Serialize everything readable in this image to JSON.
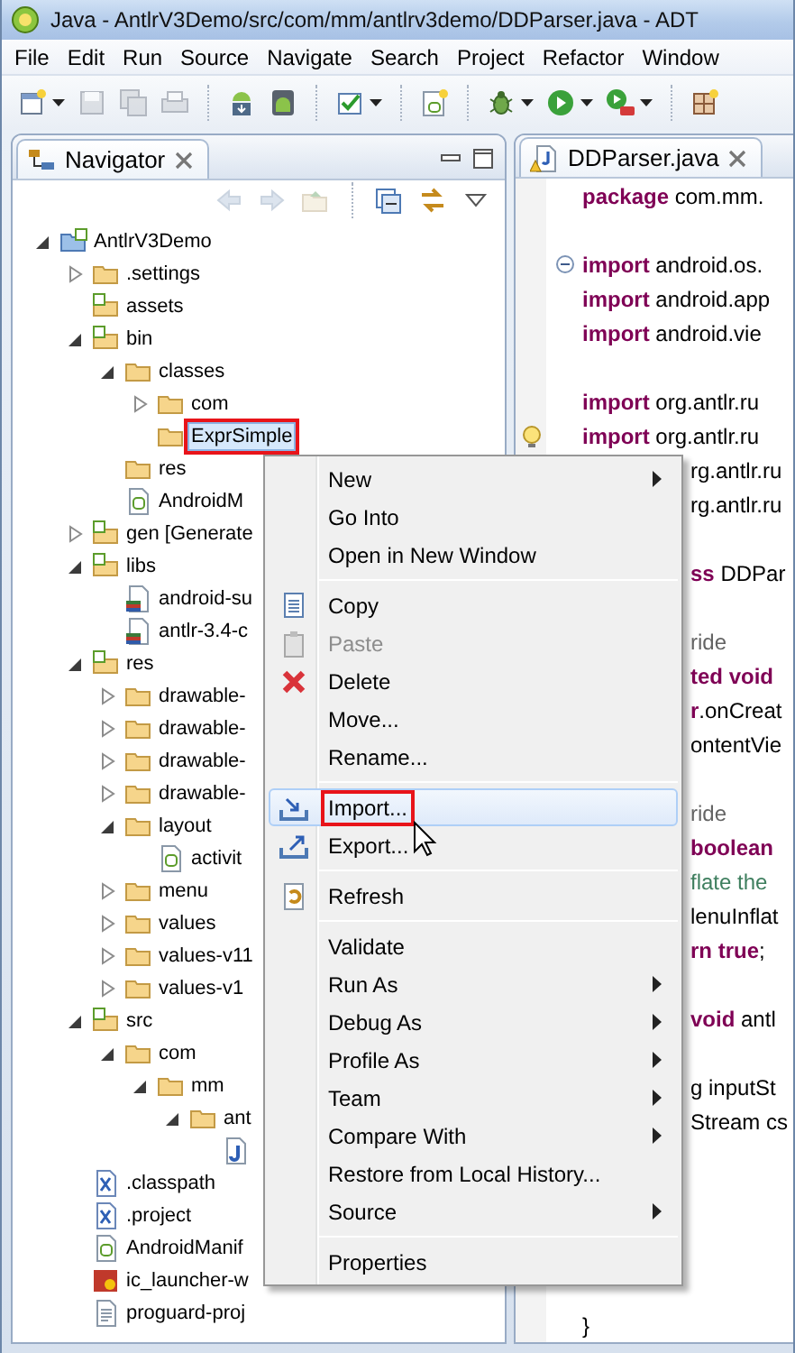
{
  "window": {
    "title": "Java - AntlrV3Demo/src/com/mm/antlrv3demo/DDParser.java - ADT"
  },
  "menu_bar": [
    "File",
    "Edit",
    "Run",
    "Source",
    "Navigate",
    "Search",
    "Project",
    "Refactor",
    "Window"
  ],
  "toolbar": [
    {
      "kind": "new",
      "disabled": false,
      "dropdown": true
    },
    {
      "kind": "save",
      "disabled": true,
      "dropdown": false
    },
    {
      "kind": "save-all",
      "disabled": true,
      "dropdown": false
    },
    {
      "kind": "print",
      "disabled": true,
      "dropdown": false
    },
    {
      "kind": "separator"
    },
    {
      "kind": "sdk",
      "disabled": false,
      "dropdown": false
    },
    {
      "kind": "avd",
      "disabled": false,
      "dropdown": false
    },
    {
      "kind": "separator"
    },
    {
      "kind": "task",
      "disabled": false,
      "dropdown": true
    },
    {
      "kind": "separator"
    },
    {
      "kind": "new-xml",
      "disabled": false,
      "dropdown": false
    },
    {
      "kind": "separator"
    },
    {
      "kind": "debug",
      "disabled": false,
      "dropdown": true
    },
    {
      "kind": "run",
      "disabled": false,
      "dropdown": true
    },
    {
      "kind": "external",
      "disabled": false,
      "dropdown": true
    },
    {
      "kind": "separator"
    },
    {
      "kind": "perspective",
      "disabled": false,
      "dropdown": false
    }
  ],
  "navigator": {
    "tab": {
      "label": "Navigator",
      "selected": true
    },
    "nav_toolbar": [
      {
        "kind": "back",
        "disabled": true
      },
      {
        "kind": "forward",
        "disabled": true
      },
      {
        "kind": "up",
        "disabled": true
      },
      {
        "kind": "separator"
      },
      {
        "kind": "collapse",
        "disabled": false
      },
      {
        "kind": "link",
        "disabled": false
      },
      {
        "kind": "view-menu",
        "disabled": false
      }
    ],
    "tree": [
      {
        "label": "AntlrV3Demo",
        "kind": "project",
        "expanded": true,
        "selected": false,
        "marked": false,
        "children": [
          {
            "label": ".settings",
            "kind": "folder",
            "expanded": false,
            "selected": false,
            "marked": false
          },
          {
            "label": "assets",
            "kind": "package-folder",
            "selected": false,
            "marked": false
          },
          {
            "label": "bin",
            "kind": "package-folder",
            "expanded": true,
            "selected": false,
            "marked": false,
            "children": [
              {
                "label": "classes",
                "kind": "folder",
                "expanded": true,
                "selected": false,
                "marked": false,
                "children": [
                  {
                    "label": "com",
                    "kind": "folder",
                    "expanded": false,
                    "selected": false,
                    "marked": false
                  },
                  {
                    "label": "ExprSimple",
                    "kind": "folder",
                    "selected": true,
                    "marked": true
                  }
                ]
              },
              {
                "label": "res",
                "kind": "folder",
                "selected": false,
                "marked": false
              },
              {
                "label": "AndroidM",
                "kind": "android-xml",
                "selected": false,
                "marked": false
              }
            ]
          },
          {
            "label": "gen [Generate",
            "kind": "package-folder",
            "expanded": false,
            "selected": false,
            "marked": false
          },
          {
            "label": "libs",
            "kind": "package-folder",
            "expanded": true,
            "selected": false,
            "marked": false,
            "children": [
              {
                "label": "android-su",
                "kind": "jar",
                "selected": false,
                "marked": false
              },
              {
                "label": "antlr-3.4-c",
                "kind": "jar",
                "selected": false,
                "marked": false
              }
            ]
          },
          {
            "label": "res",
            "kind": "package-folder",
            "expanded": true,
            "selected": false,
            "marked": false,
            "children": [
              {
                "label": "drawable-",
                "kind": "folder",
                "expanded": false,
                "selected": false,
                "marked": false
              },
              {
                "label": "drawable-",
                "kind": "folder",
                "expanded": false,
                "selected": false,
                "marked": false
              },
              {
                "label": "drawable-",
                "kind": "folder",
                "expanded": false,
                "selected": false,
                "marked": false
              },
              {
                "label": "drawable-",
                "kind": "folder",
                "expanded": false,
                "selected": false,
                "marked": false
              },
              {
                "label": "layout",
                "kind": "folder",
                "expanded": true,
                "selected": false,
                "marked": false,
                "children": [
                  {
                    "label": "activit",
                    "kind": "android-xml",
                    "selected": false,
                    "marked": false
                  }
                ]
              },
              {
                "label": "menu",
                "kind": "folder",
                "expanded": false,
                "selected": false,
                "marked": false
              },
              {
                "label": "values",
                "kind": "folder",
                "expanded": false,
                "selected": false,
                "marked": false
              },
              {
                "label": "values-v11",
                "kind": "folder",
                "expanded": false,
                "selected": false,
                "marked": false
              },
              {
                "label": "values-v1",
                "kind": "folder",
                "expanded": false,
                "selected": false,
                "marked": false
              }
            ]
          },
          {
            "label": "src",
            "kind": "package-folder",
            "expanded": true,
            "selected": false,
            "marked": false,
            "children": [
              {
                "label": "com",
                "kind": "folder",
                "expanded": true,
                "selected": false,
                "marked": false,
                "children": [
                  {
                    "label": "mm",
                    "kind": "folder",
                    "expanded": true,
                    "selected": false,
                    "marked": false,
                    "children": [
                      {
                        "label": "ant",
                        "kind": "folder",
                        "expanded": true,
                        "selected": false,
                        "marked": false,
                        "children": [
                          {
                            "kind": "java"
                          }
                        ]
                      }
                    ]
                  }
                ]
              }
            ]
          },
          {
            "label": ".classpath",
            "kind": "xml",
            "selected": false,
            "marked": false
          },
          {
            "label": ".project",
            "kind": "xml",
            "selected": false,
            "marked": false
          },
          {
            "label": "AndroidManif",
            "kind": "android-xml",
            "selected": false,
            "marked": false
          },
          {
            "label": "ic_launcher-w",
            "kind": "image",
            "selected": false,
            "marked": false
          },
          {
            "label": "proguard-proj",
            "kind": "text",
            "selected": false,
            "marked": false
          }
        ]
      }
    ]
  },
  "editor": {
    "tabs": [
      {
        "label": "DDParser.java",
        "selected": true
      }
    ],
    "blocks": [
      {
        "lines": [
          {
            "covered": false,
            "segments": [
              {
                "kind": "keyword",
                "text": "package"
              },
              {
                "kind": "plain",
                "text": " com.mm."
              }
            ]
          }
        ]
      },
      {
        "lines": [
          {
            "covered": false,
            "kind": "fold",
            "segments": [
              {
                "kind": "keyword",
                "text": "import"
              },
              {
                "kind": "plain",
                "text": " android.os."
              }
            ]
          },
          {
            "covered": false,
            "segments": [
              {
                "kind": "keyword",
                "text": "import"
              },
              {
                "kind": "plain",
                "text": " android.app"
              }
            ]
          },
          {
            "covered": false,
            "segments": [
              {
                "kind": "keyword",
                "text": "import"
              },
              {
                "kind": "plain",
                "text": " android.vie"
              }
            ]
          }
        ]
      },
      {
        "lines": [
          {
            "covered": false,
            "segments": [
              {
                "kind": "keyword",
                "text": "import"
              },
              {
                "kind": "plain",
                "text": " org.antlr.ru"
              }
            ]
          },
          {
            "covered": false,
            "kind": "warning",
            "segments": [
              {
                "kind": "keyword",
                "text": "import"
              },
              {
                "kind": "plain",
                "text": " org.antlr.ru"
              }
            ]
          },
          {
            "covered": true,
            "segments": [
              {
                "kind": "plain",
                "text": "rg.antlr.ru"
              }
            ]
          },
          {
            "covered": true,
            "segments": [
              {
                "kind": "plain",
                "text": "rg.antlr.ru"
              }
            ]
          }
        ]
      },
      {
        "lines": [
          {
            "covered": true,
            "segments": [
              {
                "kind": "keyword",
                "text": "ss"
              },
              {
                "kind": "plain",
                "text": " DDPar"
              }
            ]
          }
        ]
      },
      {
        "lines": [
          {
            "covered": true,
            "segments": [
              {
                "kind": "annotation",
                "text": "ride"
              }
            ]
          },
          {
            "covered": true,
            "segments": [
              {
                "kind": "keyword",
                "text": "ted void"
              }
            ]
          },
          {
            "covered": true,
            "segments": [
              {
                "kind": "keyword",
                "text": "r"
              },
              {
                "kind": "plain",
                "text": ".onCreat"
              }
            ]
          },
          {
            "covered": true,
            "segments": [
              {
                "kind": "plain",
                "text": "ontentVie"
              }
            ]
          }
        ]
      },
      {
        "lines": [
          {
            "covered": true,
            "segments": [
              {
                "kind": "annotation",
                "text": "ride"
              }
            ]
          },
          {
            "covered": true,
            "segments": [
              {
                "kind": "keyword",
                "text": "boolean"
              }
            ]
          },
          {
            "covered": true,
            "segments": [
              {
                "kind": "comment",
                "text": "flate the"
              }
            ]
          },
          {
            "covered": true,
            "segments": [
              {
                "kind": "plain",
                "text": "lenuInflat"
              }
            ]
          },
          {
            "covered": true,
            "segments": [
              {
                "kind": "keyword",
                "text": "rn true"
              },
              {
                "kind": "plain",
                "text": ";"
              }
            ]
          }
        ]
      },
      {
        "lines": [
          {
            "covered": true,
            "segments": [
              {
                "kind": "keyword",
                "text": "void"
              },
              {
                "kind": "plain",
                "text": " antl"
              }
            ]
          }
        ]
      },
      {
        "lines": [
          {
            "covered": true,
            "segments": [
              {
                "kind": "plain",
                "text": "g inputSt"
              }
            ]
          },
          {
            "covered": true,
            "segments": [
              {
                "kind": "plain",
                "text": "Stream cs"
              }
            ]
          }
        ]
      },
      {
        "lines": [
          {
            "covered": false,
            "segments": [
              {
                "kind": "plain",
                "text": "}"
              }
            ]
          }
        ]
      }
    ]
  },
  "context_menu": {
    "items": [
      {
        "kind": "item",
        "label": "New",
        "submenu": true,
        "disabled": false,
        "selected": false,
        "marked": false
      },
      {
        "kind": "item",
        "label": "Go Into",
        "submenu": false,
        "disabled": false,
        "selected": false,
        "marked": false
      },
      {
        "kind": "item",
        "label": "Open in New Window",
        "submenu": false,
        "disabled": false,
        "selected": false,
        "marked": false
      },
      {
        "kind": "separator"
      },
      {
        "kind": "copy",
        "label": "Copy",
        "submenu": false,
        "disabled": false,
        "selected": false,
        "marked": false
      },
      {
        "kind": "paste",
        "label": "Paste",
        "submenu": false,
        "disabled": true,
        "selected": false,
        "marked": false
      },
      {
        "kind": "delete",
        "label": "Delete",
        "submenu": false,
        "disabled": false,
        "selected": false,
        "marked": false
      },
      {
        "kind": "item",
        "label": "Move...",
        "submenu": false,
        "disabled": false,
        "selected": false,
        "marked": false
      },
      {
        "kind": "item",
        "label": "Rename...",
        "submenu": false,
        "disabled": false,
        "selected": false,
        "marked": false
      },
      {
        "kind": "separator"
      },
      {
        "kind": "import",
        "label": "Import...",
        "submenu": false,
        "disabled": false,
        "selected": true,
        "marked": true
      },
      {
        "kind": "export",
        "label": "Export...",
        "submenu": false,
        "disabled": false,
        "selected": false,
        "marked": false
      },
      {
        "kind": "separator"
      },
      {
        "kind": "refresh",
        "label": "Refresh",
        "submenu": false,
        "disabled": false,
        "selected": false,
        "marked": false
      },
      {
        "kind": "separator"
      },
      {
        "kind": "item",
        "label": "Validate",
        "submenu": false,
        "disabled": false,
        "selected": false,
        "marked": false
      },
      {
        "kind": "item",
        "label": "Run As",
        "submenu": true,
        "disabled": false,
        "selected": false,
        "marked": false
      },
      {
        "kind": "item",
        "label": "Debug As",
        "submenu": true,
        "disabled": false,
        "selected": false,
        "marked": false
      },
      {
        "kind": "item",
        "label": "Profile As",
        "submenu": true,
        "disabled": false,
        "selected": false,
        "marked": false
      },
      {
        "kind": "item",
        "label": "Team",
        "submenu": true,
        "disabled": false,
        "selected": false,
        "marked": false
      },
      {
        "kind": "item",
        "label": "Compare With",
        "submenu": true,
        "disabled": false,
        "selected": false,
        "marked": false
      },
      {
        "kind": "item",
        "label": "Restore from Local History...",
        "submenu": false,
        "disabled": false,
        "selected": false,
        "marked": false
      },
      {
        "kind": "item",
        "label": "Source",
        "submenu": true,
        "disabled": false,
        "selected": false,
        "marked": false
      },
      {
        "kind": "separator"
      },
      {
        "kind": "item",
        "label": "Properties",
        "submenu": false,
        "disabled": false,
        "selected": false,
        "marked": false
      }
    ]
  }
}
